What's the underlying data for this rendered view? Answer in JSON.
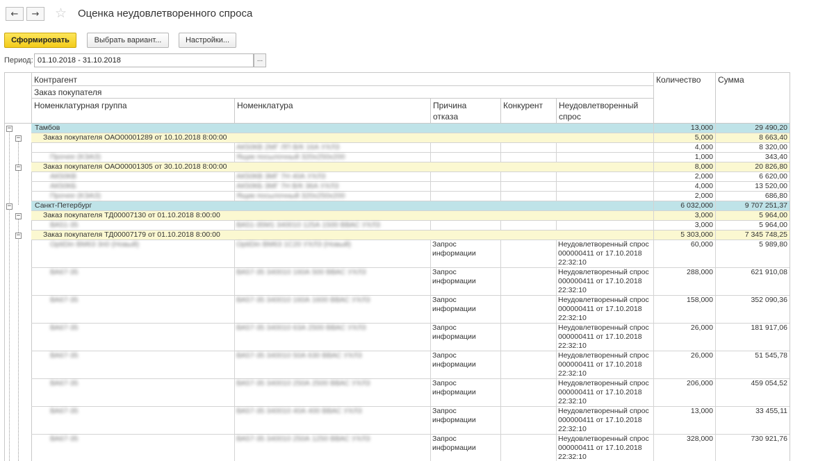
{
  "header": {
    "back": "←",
    "forward": "→",
    "favorite": "☆",
    "title": "Оценка неудовлетворенного спроса"
  },
  "toolbar": {
    "generate": "Сформировать",
    "variant": "Выбрать вариант...",
    "settings": "Настройки..."
  },
  "filter": {
    "period_label": "Период:",
    "period_value": "01.10.2018 - 31.10.2018",
    "picker": "..."
  },
  "columns": {
    "counterparty": "Контрагент",
    "order": "Заказ покупателя",
    "group": "Номенклатурная группа",
    "item": "Номенклатура",
    "reason": "Причина\nотказа",
    "competitor": "Конкурент",
    "demand": "Неудовлетворенный\nспрос",
    "qty": "Количество",
    "sum": "Сумма"
  },
  "rows": [
    {
      "kind": "cp",
      "toggle": "−",
      "text": "Тамбов",
      "qty": "13,000",
      "sum": "29 490,20"
    },
    {
      "kind": "order",
      "toggle": "−",
      "text": "Заказ покупателя ОАО00001289 от 10.10.2018 8:00:00",
      "qty": "5,000",
      "sum": "8 663,40"
    },
    {
      "kind": "item",
      "group": "",
      "item": "АК50КВ 2МГ ЛП В/К 16А УХЛ3",
      "reason": "",
      "demand": "",
      "qty": "4,000",
      "sum": "8 320,00"
    },
    {
      "kind": "item",
      "group": "Прочее (КЭАЗ)",
      "item": "Ящик посылочный 320х250х200",
      "reason": "",
      "demand": "",
      "qty": "1,000",
      "sum": "343,40"
    },
    {
      "kind": "order",
      "toggle": "−",
      "text": "Заказ покупателя ОАО00001305 от 30.10.2018 8:00:00",
      "qty": "8,000",
      "sum": "20 826,80"
    },
    {
      "kind": "item",
      "group": "АК50КВ",
      "item": "АК50КВ 3МГ 7Н 40А УХЛ3",
      "reason": "",
      "demand": "",
      "qty": "2,000",
      "sum": "6 620,00"
    },
    {
      "kind": "item",
      "group": "АК50КБ",
      "item": "АК50КБ 3МГ 7Н В/К 36А УХЛ3",
      "reason": "",
      "demand": "",
      "qty": "4,000",
      "sum": "13 520,00"
    },
    {
      "kind": "item",
      "group": "Прочее (КЭАЗ)",
      "item": "Ящик посылочный 320х250х200",
      "reason": "",
      "demand": "",
      "qty": "2,000",
      "sum": "686,80"
    },
    {
      "kind": "cp",
      "toggle": "−",
      "text": "Санкт-Петербург",
      "qty": "6 032,000",
      "sum": "9 707 251,37"
    },
    {
      "kind": "order",
      "toggle": "−",
      "text": "Заказ покупателя ТД00007130 от 01.10.2018 8:00:00",
      "qty": "3,000",
      "sum": "5 964,00"
    },
    {
      "kind": "item",
      "group": "ВА51-35",
      "item": "ВА51-35М1 340010 125А 1500 ВВАС УХЛ3",
      "reason": "",
      "demand": "",
      "qty": "3,000",
      "sum": "5 964,00"
    },
    {
      "kind": "order",
      "toggle": "−",
      "text": "Заказ покупателя ТД00007179 от 01.10.2018 8:00:00",
      "qty": "5 303,000",
      "sum": "7 345 748,25"
    },
    {
      "kind": "item",
      "group": "OptiDin BM63 3п0 (Новый)",
      "item": "OptiDin BM63 1С20 УХЛ3 (Новый)",
      "reason": "Запрос\nинформации",
      "demand": "Неудовлетворенный спрос\n000000411 от 17.10.2018\n22:32:10",
      "qty": "60,000",
      "sum": "5 989,80"
    },
    {
      "kind": "item",
      "group": "ВА67-35",
      "item": "ВА57-35 340010 160А 500 ВВАС УХЛ3",
      "reason": "Запрос\nинформации",
      "demand": "Неудовлетворенный спрос\n000000411 от 17.10.2018\n22:32:10",
      "qty": "288,000",
      "sum": "621 910,08"
    },
    {
      "kind": "item",
      "group": "ВА67-35",
      "item": "ВА57-35 340010 160А 1600 ВВАС УХЛ3",
      "reason": "Запрос\nинформации",
      "demand": "Неудовлетворенный спрос\n000000411 от 17.10.2018\n22:32:10",
      "qty": "158,000",
      "sum": "352 090,36"
    },
    {
      "kind": "item",
      "group": "ВА67-35",
      "item": "ВА57-35 340010 63А 2500 ВВАС УХЛ3",
      "reason": "Запрос\nинформации",
      "demand": "Неудовлетворенный спрос\n000000411 от 17.10.2018\n22:32:10",
      "qty": "26,000",
      "sum": "181 917,06"
    },
    {
      "kind": "item",
      "group": "ВА67-35",
      "item": "ВА57-35 340010 50А 630 ВВАС УХЛ3",
      "reason": "Запрос\nинформации",
      "demand": "Неудовлетворенный спрос\n000000411 от 17.10.2018\n22:32:10",
      "qty": "26,000",
      "sum": "51 545,78"
    },
    {
      "kind": "item",
      "group": "ВА67-35",
      "item": "ВА57-35 340010 250А 2500 ВВАС УХЛ3",
      "reason": "Запрос\nинформации",
      "demand": "Неудовлетворенный спрос\n000000411 от 17.10.2018\n22:32:10",
      "qty": "206,000",
      "sum": "459 054,52"
    },
    {
      "kind": "item",
      "group": "ВА67-35",
      "item": "ВА57-35 340010 40А 400 ВВАС УХЛ3",
      "reason": "Запрос\nинформации",
      "demand": "Неудовлетворенный спрос\n000000411 от 17.10.2018\n22:32:10",
      "qty": "13,000",
      "sum": "33 455,11"
    },
    {
      "kind": "item",
      "group": "ВА67-35",
      "item": "ВА57-35 340010 250А 1250 ВВАС УХЛ3",
      "reason": "Запрос\nинформации",
      "demand": "Неудовлетворенный спрос\n000000411 от 17.10.2018\n22:32:10",
      "qty": "328,000",
      "sum": "730 921,76"
    }
  ]
}
